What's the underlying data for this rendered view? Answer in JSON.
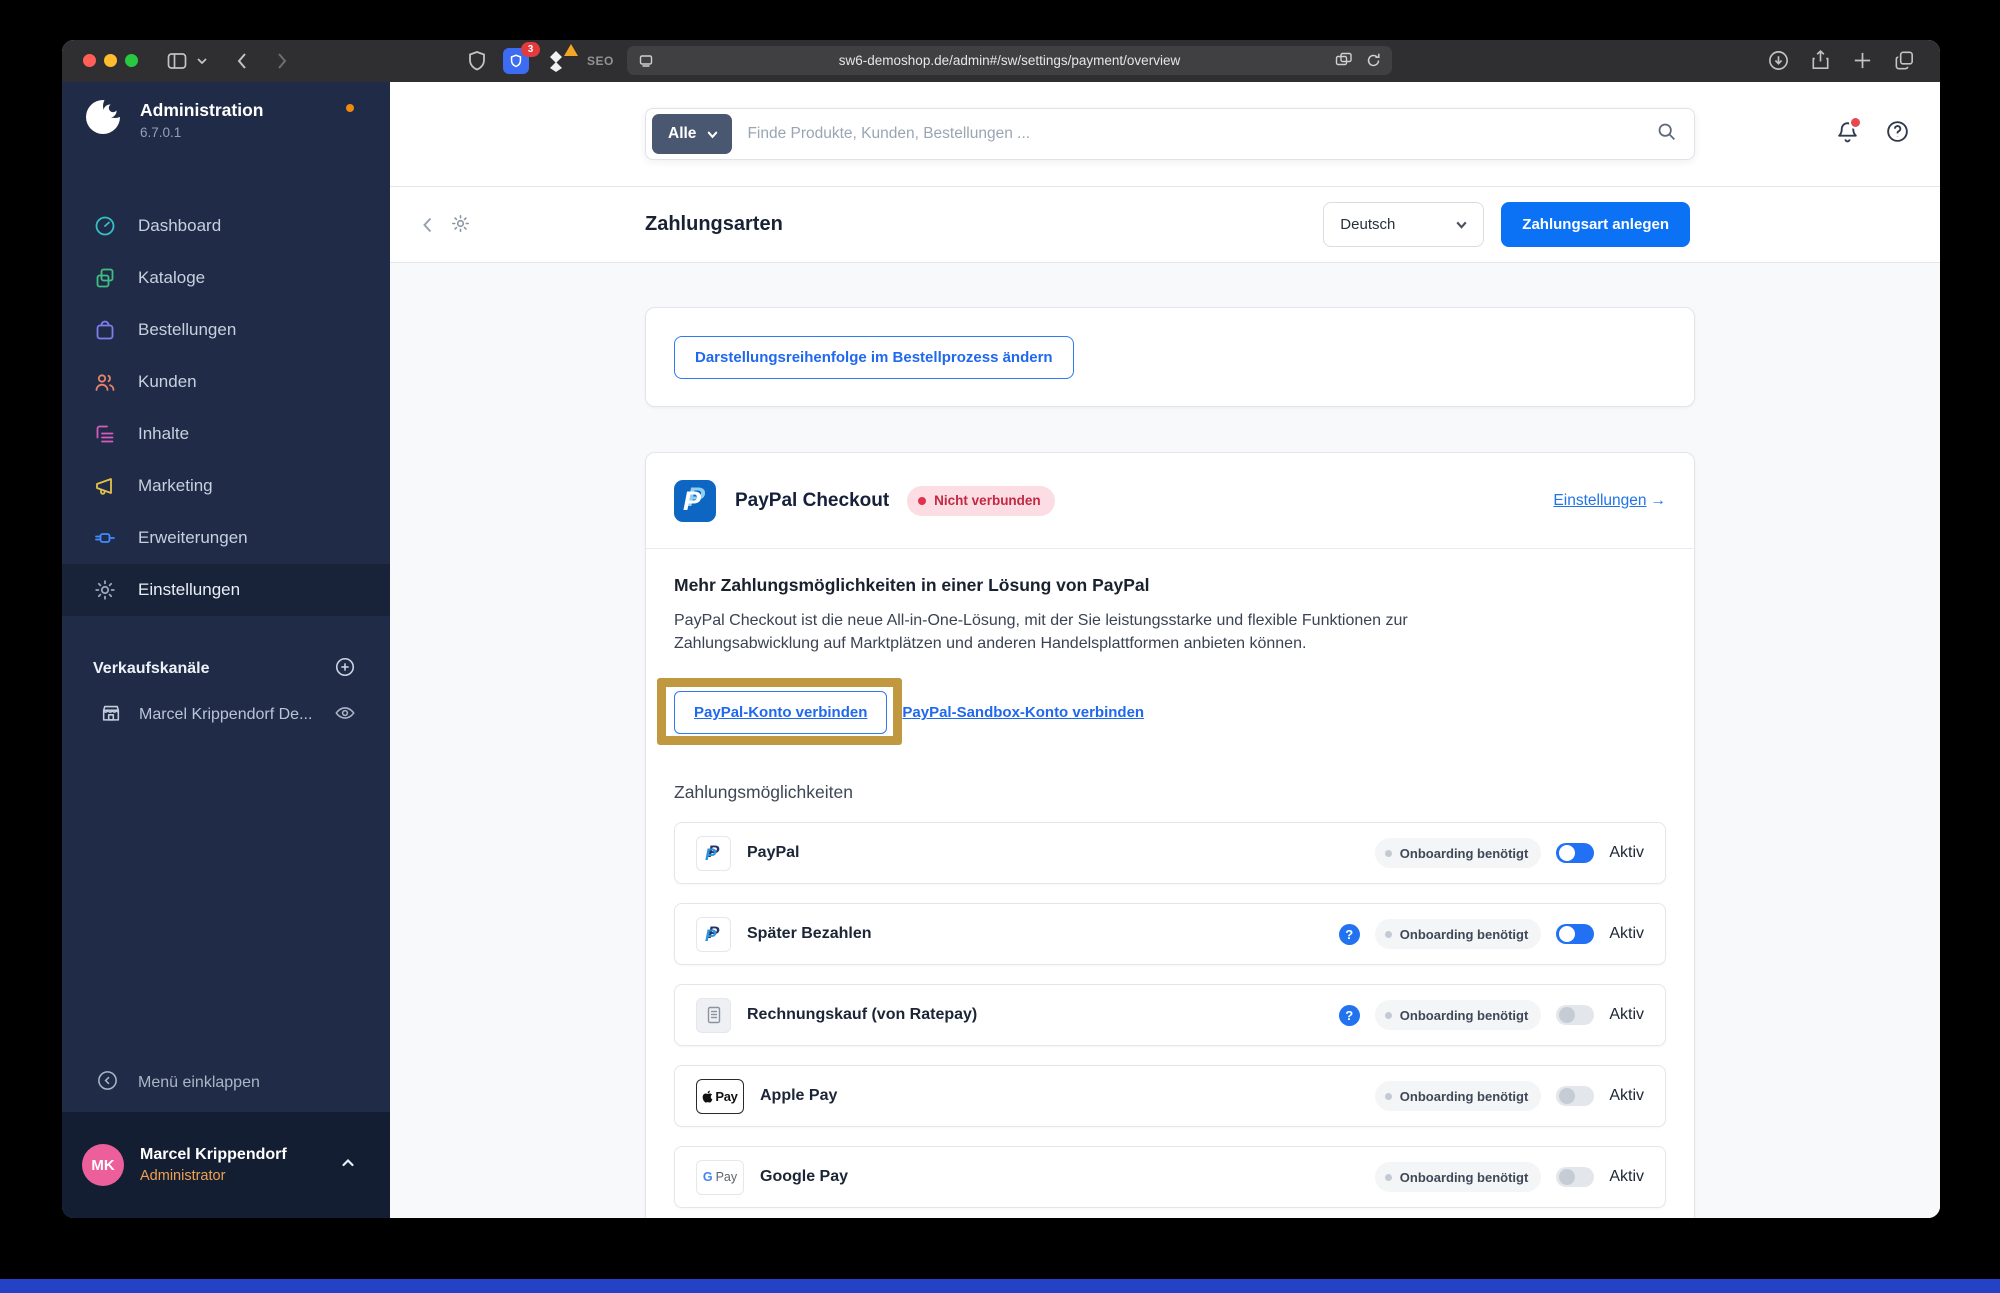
{
  "browser": {
    "url": "sw6-demoshop.de/admin#/sw/settings/payment/overview",
    "extension_badge": "3",
    "seo_label": "SEO"
  },
  "sidebar": {
    "app_title": "Administration",
    "version": "6.7.0.1",
    "items": [
      {
        "label": "Dashboard",
        "icon": "gauge-icon",
        "color": "#35c0c5",
        "active": false
      },
      {
        "label": "Kataloge",
        "icon": "catalog-icon",
        "color": "#3fbf7f",
        "active": false
      },
      {
        "label": "Bestellungen",
        "icon": "orders-bag-icon",
        "color": "#7d7ff0",
        "active": false
      },
      {
        "label": "Kunden",
        "icon": "customers-icon",
        "color": "#e8826a",
        "active": false
      },
      {
        "label": "Inhalte",
        "icon": "content-icon",
        "color": "#d75bbf",
        "active": false
      },
      {
        "label": "Marketing",
        "icon": "megaphone-icon",
        "color": "#e2c14b",
        "active": false
      },
      {
        "label": "Erweiterungen",
        "icon": "plug-icon",
        "color": "#3f8bff",
        "active": false
      },
      {
        "label": "Einstellungen",
        "icon": "gear-icon",
        "color": "#9aa7ba",
        "active": true
      }
    ],
    "sales_channels": {
      "heading": "Verkaufskanäle",
      "channel_name": "Marcel Krippendorf De..."
    },
    "collapse_label": "Menü einklappen",
    "user": {
      "initials": "MK",
      "name": "Marcel Krippendorf",
      "role": "Administrator",
      "avatar_color": "#ec5f9b",
      "role_color": "#efa14f"
    }
  },
  "topbar": {
    "filter_label": "Alle",
    "search_placeholder": "Finde Produkte, Kunden, Bestellungen ..."
  },
  "smartbar": {
    "title": "Zahlungsarten",
    "language": "Deutsch",
    "create_button": "Zahlungsart anlegen"
  },
  "content": {
    "order_button": "Darstellungsreihenfolge im Bestellprozess ändern",
    "paypal": {
      "title": "PayPal Checkout",
      "status_badge": "Nicht verbunden",
      "settings_link": "Einstellungen",
      "settings_arrow": "→",
      "heading": "Mehr Zahlungsmöglichkeiten in einer Lösung von PayPal",
      "description": "PayPal Checkout ist die neue All-in-One-Lösung, mit der Sie leistungsstarke und flexible Funktionen zur Zahlungsabwicklung auf Marktplätzen und anderen Handelsplattformen anbieten können.",
      "connect_button": "PayPal-Konto verbinden",
      "sandbox_link": "PayPal-Sandbox-Konto verbinden",
      "methods_heading": "Zahlungsmöglichkeiten",
      "onboarding_badge": "Onboarding benötigt",
      "toggle_label": "Aktiv",
      "help_glyph": "?",
      "methods": [
        {
          "name": "PayPal",
          "icon": "paypal-icon",
          "help": false,
          "active": true
        },
        {
          "name": "Später Bezahlen",
          "icon": "paypal-icon",
          "help": true,
          "active": true
        },
        {
          "name": "Rechnungskauf (von Ratepay)",
          "icon": "invoice-icon",
          "help": true,
          "active": false
        },
        {
          "name": "Apple Pay",
          "icon": "apple-pay-icon",
          "help": false,
          "active": false
        },
        {
          "name": "Google Pay",
          "icon": "google-pay-icon",
          "help": false,
          "active": false
        }
      ]
    }
  },
  "colors": {
    "primary_blue": "#0b72f5",
    "link_blue": "#2068ee",
    "status_red": "#c22844",
    "status_badge_bg": "#fbdde3",
    "highlight_gold": "#bb8f30",
    "toggle_on": "#2270f4",
    "sidebar_bg": "#202c47"
  }
}
